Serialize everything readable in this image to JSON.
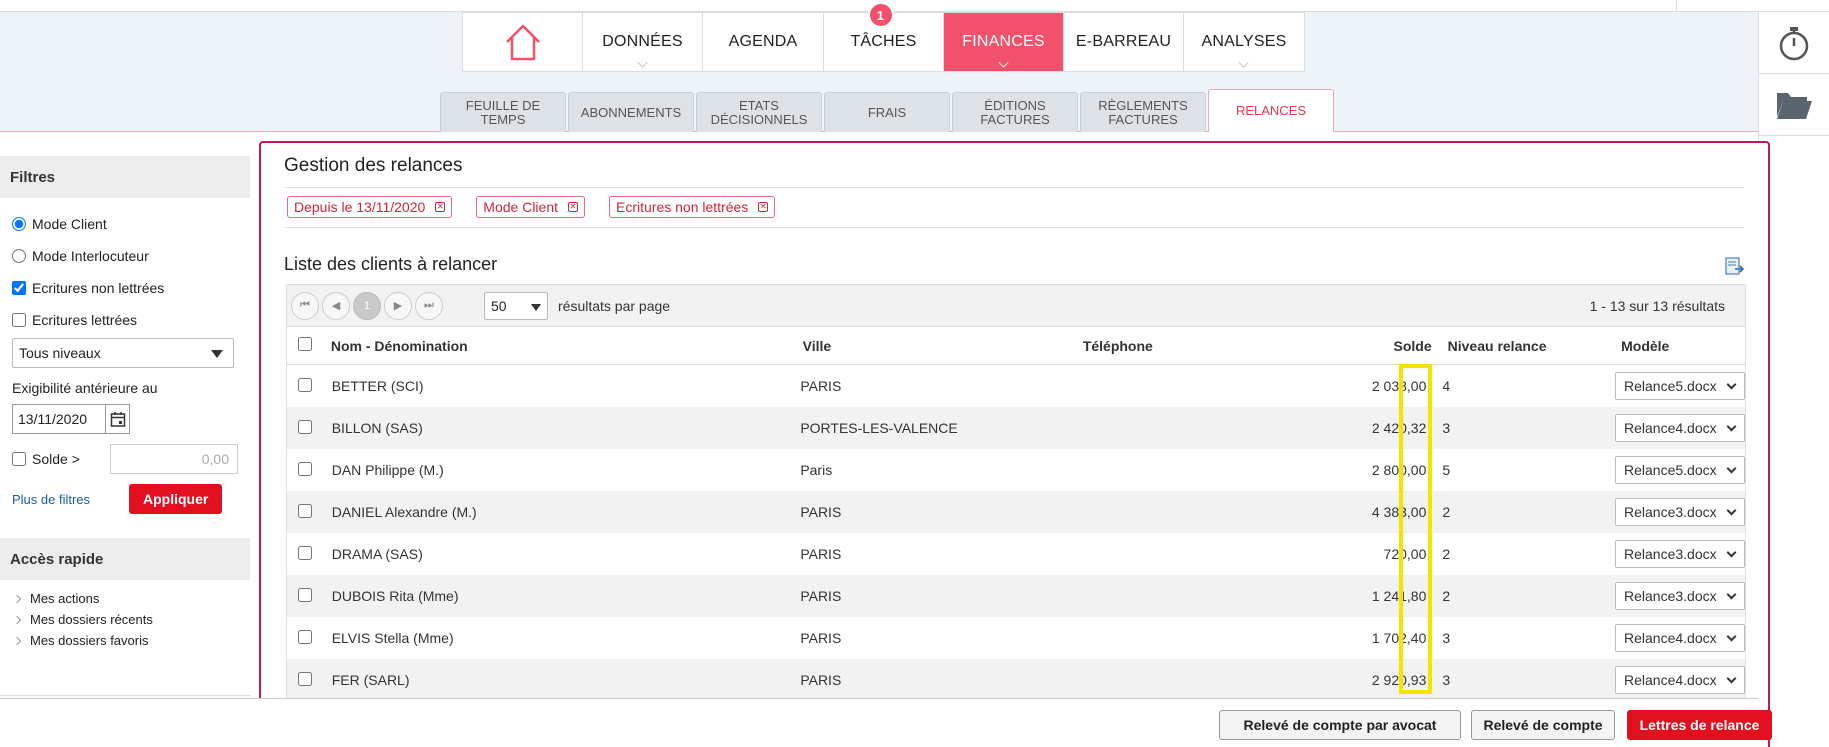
{
  "mainnav": {
    "home_icon": "home-icon",
    "items": [
      {
        "label": "DONNÉES"
      },
      {
        "label": "AGENDA"
      },
      {
        "label": "TÂCHES",
        "badge": "1"
      },
      {
        "label": "FINANCES"
      },
      {
        "label": "E-BARREAU"
      },
      {
        "label": "ANALYSES"
      }
    ],
    "active_index": 3,
    "accent": "#f2516b"
  },
  "subtabs": [
    {
      "label": "FEUILLE DE TEMPS"
    },
    {
      "label": "ABONNEMENTS"
    },
    {
      "label": "ETATS DÉCISIONNELS"
    },
    {
      "label": "FRAIS"
    },
    {
      "label": "ÉDITIONS FACTURES"
    },
    {
      "label": "RÈGLEMENTS FACTURES"
    },
    {
      "label": "RELANCES"
    }
  ],
  "rightbar": {
    "icons": [
      "stopwatch-icon",
      "folder-icon"
    ]
  },
  "sidebar": {
    "filters_title": "Filtres",
    "mode_client": "Mode Client",
    "mode_interlocuteur": "Mode Interlocuteur",
    "ecritures_non_lettrees": "Ecritures non lettrées",
    "ecritures_lettrees": "Ecritures lettrées",
    "niveau_select": "Tous niveaux",
    "exigibilite_label": "Exigibilité antérieure au",
    "date_value": "13/11/2020",
    "solde_label": "Solde >",
    "solde_value": "0,00",
    "more_filters": "Plus de filtres",
    "apply": "Appliquer",
    "quick_title": "Accès rapide",
    "quick_links": [
      "Mes actions",
      "Mes dossiers récents",
      "Mes dossiers favoris"
    ]
  },
  "main": {
    "title": "Gestion des relances",
    "chips": [
      "Depuis le 13/11/2020",
      "Mode Client",
      "Ecritures non lettrées"
    ],
    "list_title": "Liste des clients à relancer",
    "pager": {
      "current_page": "1",
      "per_page": "50",
      "per_page_label": "résultats par page",
      "count": "1 - 13 sur 13 résultats"
    },
    "columns": [
      "Nom - Dénomination",
      "Ville",
      "Téléphone",
      "Solde",
      "Niveau relance",
      "Modèle"
    ],
    "rows": [
      {
        "nom": "BETTER (SCI)",
        "ville": "PARIS",
        "telephone": "",
        "solde": "2 038,00",
        "niveau": "4",
        "modele": "Relance5.docx"
      },
      {
        "nom": "BILLON (SAS)",
        "ville": "PORTES-LES-VALENCE",
        "telephone": "",
        "solde": "2 420,32",
        "niveau": "3",
        "modele": "Relance4.docx"
      },
      {
        "nom": "DAN Philippe (M.)",
        "ville": "Paris",
        "telephone": "",
        "solde": "2 800,00",
        "niveau": "5",
        "modele": "Relance5.docx"
      },
      {
        "nom": "DANIEL Alexandre (M.)",
        "ville": "PARIS",
        "telephone": "",
        "solde": "4 383,00",
        "niveau": "2",
        "modele": "Relance3.docx"
      },
      {
        "nom": "DRAMA (SAS)",
        "ville": "PARIS",
        "telephone": "",
        "solde": "720,00",
        "niveau": "2",
        "modele": "Relance3.docx"
      },
      {
        "nom": "DUBOIS Rita (Mme)",
        "ville": "PARIS",
        "telephone": "",
        "solde": "1 241,80",
        "niveau": "2",
        "modele": "Relance3.docx"
      },
      {
        "nom": "ELVIS Stella (Mme)",
        "ville": "PARIS",
        "telephone": "",
        "solde": "1 702,40",
        "niveau": "3",
        "modele": "Relance4.docx"
      },
      {
        "nom": "FER (SARL)",
        "ville": "PARIS",
        "telephone": "",
        "solde": "2 920,93",
        "niveau": "3",
        "modele": "Relance4.docx"
      }
    ]
  },
  "bottom": {
    "btn_avocat": "Relevé de compte par avocat",
    "btn_compte": "Relevé de compte",
    "btn_lettres": "Lettres de relance"
  },
  "colors": {
    "primary_red": "#e2101f",
    "panel_border": "#c2185b",
    "highlight": "#f5e400"
  }
}
